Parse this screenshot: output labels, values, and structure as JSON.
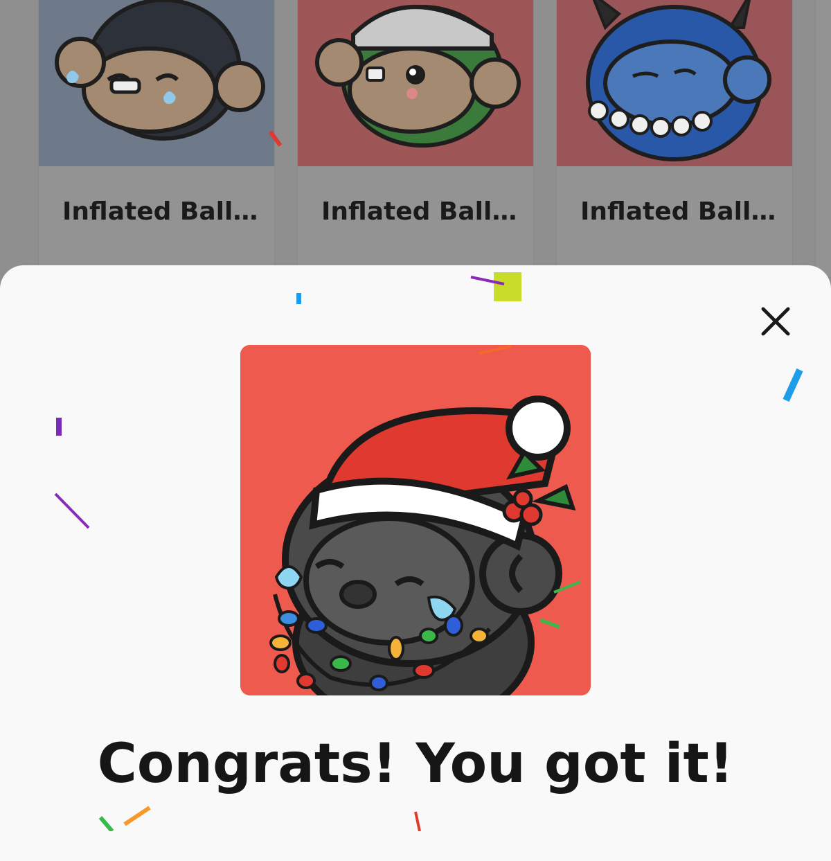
{
  "collection": {
    "items": [
      {
        "label": "Inflated Ball…",
        "bg_color": "#6e7a8a",
        "body_color": "#2d313a"
      },
      {
        "label": "Inflated Ball…",
        "bg_color": "#9e5656",
        "body_color": "#3a7a3a"
      },
      {
        "label": "Inflated Ball…",
        "bg_color": "#9a5558",
        "body_color": "#2a58a8"
      }
    ]
  },
  "reward_sheet": {
    "close_icon": "close-icon",
    "image": {
      "bg_color": "#ee5a4d",
      "character": "black monkey with santa hat and christmas lights"
    },
    "title": "Congrats! You got it!"
  }
}
